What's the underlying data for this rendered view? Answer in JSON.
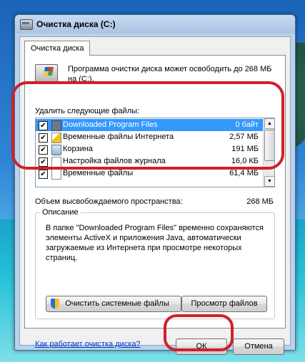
{
  "window": {
    "title": "Очистка диска  (C:)"
  },
  "tab": {
    "label": "Очистка диска"
  },
  "intro": {
    "text": "Программа очистки диска может освободить до 268 МБ на (C:)."
  },
  "files": {
    "caption": "Удалить следующие файлы:",
    "items": [
      {
        "name": "Downloaded Program Files",
        "size": "0 байт",
        "checked": "✔",
        "icon": "folder-icon"
      },
      {
        "name": "Временные файлы Интернета",
        "size": "2,57 МБ",
        "checked": "✔",
        "icon": "internet-files-icon"
      },
      {
        "name": "Корзина",
        "size": "191 МБ",
        "checked": "✔",
        "icon": "recycle-bin-icon"
      },
      {
        "name": "Настройка файлов журнала",
        "size": "16,0 КБ",
        "checked": "✔",
        "icon": "document-icon"
      },
      {
        "name": "Временные файлы",
        "size": "61,4 МБ",
        "checked": "✔",
        "icon": "document-icon"
      }
    ]
  },
  "space": {
    "label": "Объем высвобождаемого пространства:",
    "value": "268 МБ"
  },
  "description": {
    "legend": "Описание",
    "text": "В папке \"Downloaded Program Files\" временно сохраняются элементы ActiveX и приложения Java, автоматически загружаемые из Интернета при просмотре некоторых страниц."
  },
  "buttons": {
    "clean_system": "Очистить системные файлы",
    "view_files": "Просмотр файлов",
    "ok": "ОК",
    "cancel": "Отмена"
  },
  "help_link": "Как работает очистка диска?",
  "colors": {
    "highlight": "#d0202c",
    "selection": "#3399ff",
    "link": "#0033cc"
  }
}
